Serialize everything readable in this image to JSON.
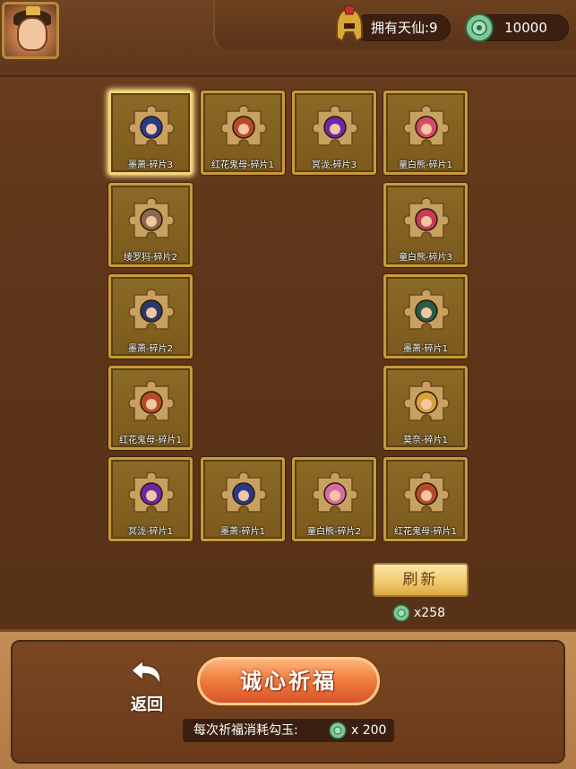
{
  "header": {
    "immortal_label": "拥有天仙:9",
    "jade_amount": "10000"
  },
  "icons": {
    "avatar": "hero-portrait-avatar",
    "immortal": "helmet-icon",
    "jade": "jade-coin-icon",
    "back": "back-arrow-icon"
  },
  "grid": {
    "cells": [
      {
        "label": "墨萧-碎片3",
        "color": "#2a3a8a",
        "selected": true
      },
      {
        "label": "红花鬼母-碎片1",
        "color": "#b84a2a",
        "selected": false
      },
      {
        "label": "冥泷-碎片3",
        "color": "#6a2aa8",
        "selected": false
      },
      {
        "label": "童白熊-碎片1",
        "color": "#d84a6a",
        "selected": false
      },
      {
        "label": "绫罗犸-碎片2",
        "color": "#8a6a4a",
        "selected": false
      },
      {
        "label": "童白熊-碎片3",
        "color": "#c83a5a",
        "selected": false
      },
      {
        "label": "墨萧-碎片2",
        "color": "#2a3a6a",
        "selected": false
      },
      {
        "label": "墨萧-碎片1",
        "color": "#2a5a4a",
        "selected": false
      },
      {
        "label": "红花鬼母-碎片1",
        "color": "#b84a2a",
        "selected": false
      },
      {
        "label": "莫奈-碎片1",
        "color": "#d8a03a",
        "selected": false
      },
      {
        "label": "冥泷-碎片1",
        "color": "#6a2aa8",
        "selected": false
      },
      {
        "label": "墨萧-碎片1",
        "color": "#2a3a8a",
        "selected": false
      },
      {
        "label": "童白熊-碎片2",
        "color": "#d86aa8",
        "selected": false
      },
      {
        "label": "红花鬼母-碎片1",
        "color": "#b84a2a",
        "selected": false
      }
    ]
  },
  "refresh": {
    "label": "刷新",
    "cost": "x258"
  },
  "actions": {
    "back_label": "返回",
    "pray_label": "诚心祈福",
    "pray_cost_text": "每次祈福消耗勾玉:",
    "pray_cost_value": "x 200"
  },
  "colors": {
    "panel_brown": "#5a3318",
    "cell_gold": "#c89a3c",
    "pray_orange": "#f07a3c",
    "refresh_gold": "#f0c86a"
  }
}
